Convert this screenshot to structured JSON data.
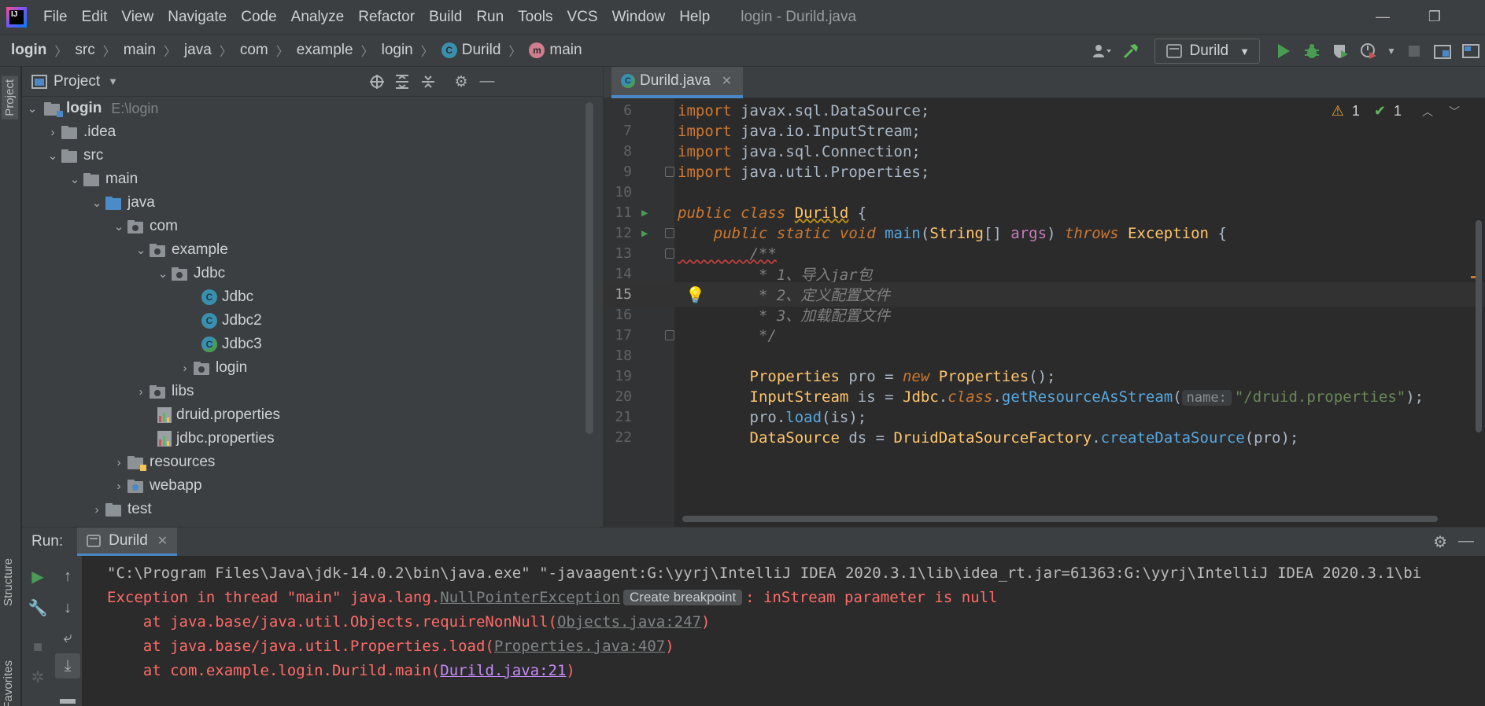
{
  "menubar": {
    "items": [
      "File",
      "Edit",
      "View",
      "Navigate",
      "Code",
      "Analyze",
      "Refactor",
      "Build",
      "Run",
      "Tools",
      "VCS",
      "Window",
      "Help"
    ],
    "window_title": "login - Durild.java",
    "minimize": "—",
    "restore": "❐"
  },
  "breadcrumbs": {
    "items": [
      "login",
      "src",
      "main",
      "java",
      "com",
      "example",
      "login",
      "Durild",
      "main"
    ],
    "separator": "〉",
    "class_icon": "C",
    "method_icon": "m"
  },
  "toolbar": {
    "run_config": "Durild",
    "run_config_caret": "▼"
  },
  "stripe": {
    "project_label": "Project",
    "structure_label": "Structure",
    "favorites_label": "Favorites"
  },
  "project_panel": {
    "title": "Project",
    "caret": "▼",
    "tree": [
      {
        "label": "login",
        "sub": "E:\\login",
        "arrow": "⌄",
        "bold": true
      },
      {
        "label": ".idea",
        "arrow": "›"
      },
      {
        "label": "src",
        "arrow": "⌄"
      },
      {
        "label": "main",
        "arrow": "⌄"
      },
      {
        "label": "java",
        "arrow": "⌄"
      },
      {
        "label": "com",
        "arrow": "⌄"
      },
      {
        "label": "example",
        "arrow": "⌄"
      },
      {
        "label": "Jdbc",
        "arrow": "⌄"
      },
      {
        "label": "Jdbc",
        "icon": "C"
      },
      {
        "label": "Jdbc2",
        "icon": "C"
      },
      {
        "label": "Jdbc3",
        "icon": "C"
      },
      {
        "label": "login",
        "arrow": "›"
      },
      {
        "label": "libs",
        "arrow": "›"
      },
      {
        "label": "druid.properties"
      },
      {
        "label": "jdbc.properties"
      },
      {
        "label": "resources",
        "arrow": "›"
      },
      {
        "label": "webapp",
        "arrow": "›"
      },
      {
        "label": "test",
        "arrow": "›"
      }
    ]
  },
  "editor": {
    "tab_label": "Durild.java",
    "tab_icon": "C",
    "tab_close": "✕",
    "warnings_count": "1",
    "checks_count": "1",
    "line_numbers": [
      "6",
      "7",
      "8",
      "9",
      "10",
      "11",
      "12",
      "13",
      "14",
      "15",
      "16",
      "17",
      "18",
      "19",
      "20",
      "21",
      "22"
    ],
    "code": {
      "l6_kw": "import",
      "l6_rest": " javax.sql.DataSource;",
      "l7_kw": "import",
      "l7_rest": " java.io.InputStream;",
      "l8_kw": "import",
      "l8_rest": " java.sql.Connection;",
      "l9_kw": "import",
      "l9_rest": " java.util.Properties;",
      "l11_a": "public class ",
      "l11_cls": "Durild",
      "l11_b": " {",
      "l12_a": "    public static void ",
      "l12_m": "main",
      "l12_b": "(",
      "l12_type": "String",
      "l12_c": "[] ",
      "l12_args": "args",
      "l12_d": ") ",
      "l12_throws": "throws",
      "l12_e": " ",
      "l12_exc": "Exception",
      "l12_f": " {",
      "l13": "        /**",
      "l14": "         * 1、导入jar包",
      "l15": "         * 2、定义配置文件",
      "l16": "         * 3、加载配置文件",
      "l17": "         */",
      "l19_a": "        ",
      "l19_t": "Properties",
      "l19_b": " pro = ",
      "l19_new": "new",
      "l19_c": " ",
      "l19_t2": "Properties",
      "l19_d": "();",
      "l20_a": "        ",
      "l20_t": "InputStream",
      "l20_b": " is = ",
      "l20_c": "Jdbc",
      "l20_d": ".",
      "l20_class": "class",
      "l20_e": ".",
      "l20_m": "getResourceAsStream",
      "l20_f": "(",
      "l20_hint": "name:",
      "l20_str": "\"/druid.properties\"",
      "l20_g": ");",
      "l21_a": "        pro.",
      "l21_m": "load",
      "l21_b": "(is);",
      "l22_a": "        ",
      "l22_t": "DataSource",
      "l22_b": " ds = ",
      "l22_c": "DruidDataSourceFactory",
      "l22_d": ".",
      "l22_m": "createDataSource",
      "l22_e": "(pro);"
    }
  },
  "run_panel": {
    "label": "Run:",
    "tab_label": "Durild",
    "tab_close": "✕",
    "console": {
      "cmd": "\"C:\\Program Files\\Java\\jdk-14.0.2\\bin\\java.exe\" \"-javaagent:G:\\yyrj\\IntelliJ IDEA 2020.3.1\\lib\\idea_rt.jar=61363:G:\\yyrj\\IntelliJ IDEA 2020.3.1\\bi",
      "exc_a": "Exception in thread \"main\" java.lang.",
      "exc_link": "NullPointerException",
      "exc_badge": "Create breakpoint",
      "exc_b": ": inStream parameter is null",
      "st1_a": "    at java.base/java.util.Objects.requireNonNull(",
      "st1_link": "Objects.java:247",
      "st1_b": ")",
      "st2_a": "    at java.base/java.util.Properties.load(",
      "st2_link": "Properties.java:407",
      "st2_b": ")",
      "st3_a": "    at com.example.login.Durild.main(",
      "st3_link": "Durild.java:21",
      "st3_b": ")"
    }
  },
  "colors": {
    "background": "#2b2b2b",
    "panel": "#3c3f41",
    "accent": "#4a88c7",
    "error_text": "#ff6b68",
    "keyword": "#cc7832",
    "string": "#6a8759"
  }
}
